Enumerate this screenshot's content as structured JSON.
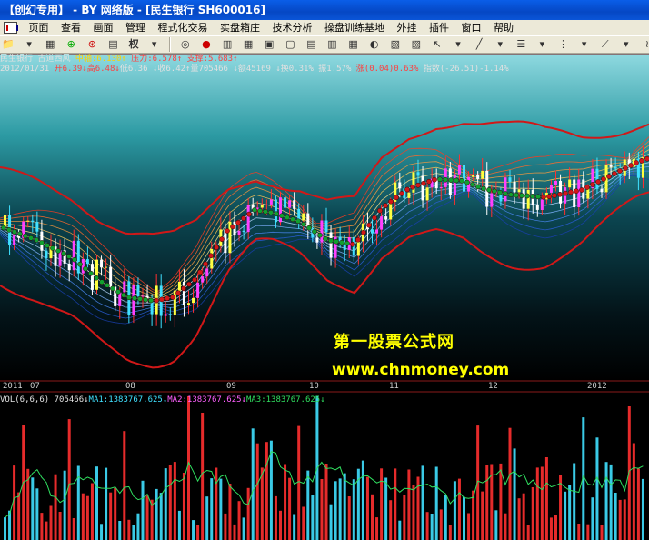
{
  "window": {
    "title": "【创幻专用】 - BY 网络版 - [民生银行 SH600016]"
  },
  "menu": {
    "items": [
      "页面",
      "查看",
      "画面",
      "管理",
      "程式化交易",
      "实盘箱庄",
      "技术分析",
      "操盘训练基地",
      "外挂",
      "插件",
      "窗口",
      "帮助"
    ]
  },
  "toolbar": {
    "quan_label": "权",
    "font_label": "A"
  },
  "stock_info": {
    "name": "民生银行",
    "indicator": "古道西风",
    "mid_label": "中轴:6.130",
    "pressure_label": "压力:6.578",
    "support_label": "支撑:5.683"
  },
  "quote": {
    "date": "2012/01/31",
    "open": "开6.39",
    "high": "高6.48",
    "low": "低6.36",
    "close": "收6.42",
    "volume": "量705466",
    "amount": "额45169",
    "turnover": "换0.31%",
    "amplitude": "振1.57%",
    "change": "涨(0.04)0.63%",
    "index": "指数(-26.51)-1.14%"
  },
  "dates": [
    "2011",
    "07",
    "08",
    "09",
    "10",
    "11",
    "12",
    "2012"
  ],
  "volume_info": {
    "title": "VOL(6,6,6)",
    "vol": "705466",
    "ma1": "MA1:1383767.625",
    "ma2": "MA2:1383767.625",
    "ma3": "MA3:1383767.625"
  },
  "watermark": {
    "title": "第一股票公式网",
    "url": "www.chnmoney.com"
  },
  "colors": {
    "up": "#ff3030",
    "down": "#40e0ff",
    "band": "#d01818",
    "mid_up": "#d01818",
    "mid_down": "#10a030"
  }
}
